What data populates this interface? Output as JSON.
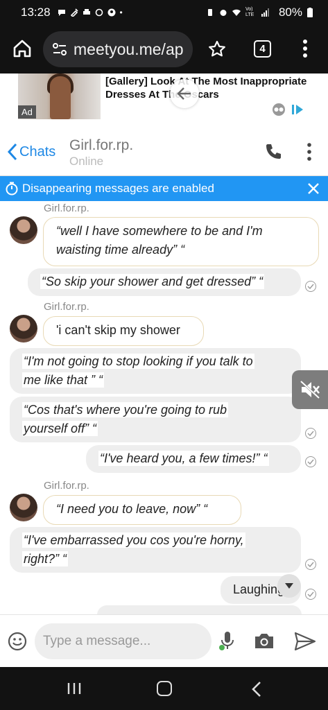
{
  "status_bar": {
    "time": "13:28",
    "signal_label": "Vo) LTE",
    "battery": "80%"
  },
  "browser": {
    "url": "meetyou.me/ap",
    "tab_count": "4"
  },
  "ad": {
    "headline": "[Gallery] Look At The Most Inappropriate Dresses At The Oscars",
    "label": "Ad"
  },
  "chat_header": {
    "back_label": "Chats",
    "contact_name": "Girl.for.rp.",
    "status": "Online"
  },
  "banner": {
    "text": "Disappearing messages are enabled"
  },
  "messages": [
    {
      "direction": "in",
      "sender": "Girl.for.rp.",
      "text_lines": [
        "“well I have somewhere to be and I'm",
        "waisting time already” “"
      ]
    },
    {
      "direction": "out",
      "text_lines": [
        "“So skip your shower and get dressed” “"
      ],
      "read": true
    },
    {
      "direction": "in",
      "sender": "Girl.for.rp.",
      "text_lines": [
        "'i can't skip my shower"
      ]
    },
    {
      "direction": "out",
      "text_lines": [
        "“I'm not going to stop looking if you talk to",
        "me like that ” “"
      ],
      "read": false
    },
    {
      "direction": "out",
      "text_lines": [
        "“Cos that's where you're going to rub",
        "yourself off” “"
      ],
      "read": true
    },
    {
      "direction": "out",
      "text_lines": [
        "“I've heard you, a few times!” “"
      ],
      "read": true
    },
    {
      "direction": "in",
      "sender": "Girl.for.rp.",
      "text_lines": [
        "“I need you to leave, now” “"
      ]
    },
    {
      "direction": "out",
      "text_lines": [
        "“I've embarrassed you cos you're horny,",
        "right?” “"
      ],
      "read": true
    },
    {
      "direction": "out",
      "text_lines": [
        "Laughing"
      ],
      "read": true
    }
  ],
  "composer": {
    "placeholder": "Type a message..."
  },
  "colors": {
    "accent": "#2196f3",
    "link": "#1e88e5",
    "incoming_border": "#e8d9b5",
    "outgoing_bg": "#eeeeee"
  },
  "icons": [
    "home-icon",
    "site-settings-icon",
    "star-icon",
    "menu-icon",
    "chevron-left-icon",
    "phone-icon",
    "timer-icon",
    "close-icon",
    "mute-icon",
    "chevron-down-icon",
    "emoji-icon",
    "mic-icon",
    "camera-icon",
    "send-icon",
    "recents-icon",
    "home-button-icon",
    "back-icon"
  ]
}
